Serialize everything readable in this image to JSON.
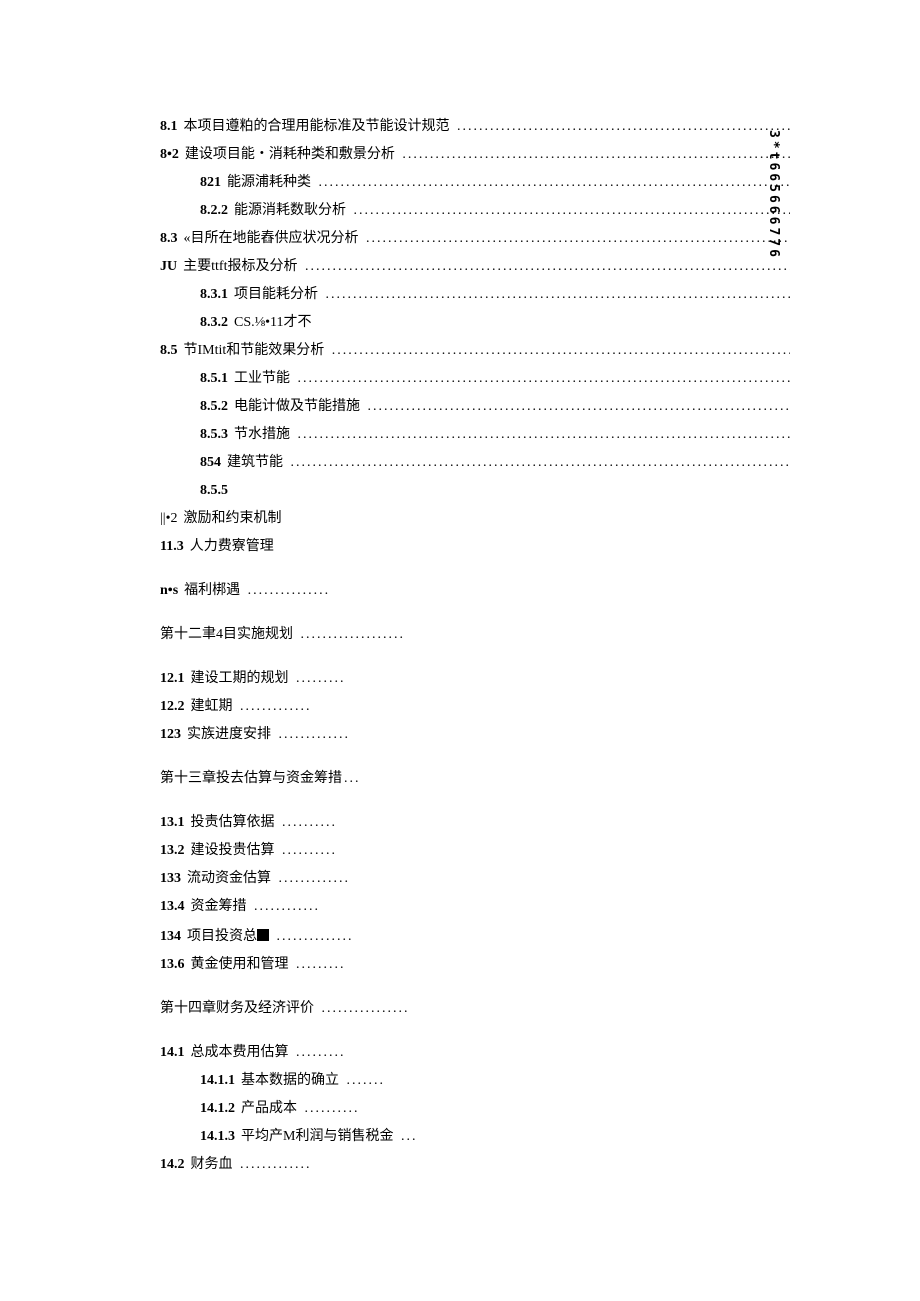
{
  "vertical_note": "3*t665666776",
  "lines": [
    {
      "cls": "toc-line",
      "num_bold": true,
      "num": "8.1",
      "title": "本项目遵粕的合理用能标准及节能设计规范",
      "dots": "long"
    },
    {
      "cls": "toc-line",
      "num_bold": true,
      "num": "8•2",
      "title": "建设项目能・消耗种类和敷景分析",
      "dots": "long"
    },
    {
      "cls": "toc-line indent-1",
      "num_bold": true,
      "num": "821",
      "title": "能源浦耗种类",
      "dots": "long"
    },
    {
      "cls": "toc-line indent-1",
      "num_bold": true,
      "num": "8.2.2",
      "title": "能源消耗数耿分析",
      "dots": "long"
    },
    {
      "cls": "toc-line",
      "num_bold": true,
      "num": "8.3",
      "title": "«目所在地能舂供应状况分析",
      "dots": "long"
    },
    {
      "cls": "toc-line",
      "num_bold": true,
      "num": "JU",
      "title": "主要ttft报标及分析",
      "dots": "long"
    },
    {
      "cls": "toc-line indent-1",
      "num_bold": true,
      "num": "8.3.1",
      "title": "  项目能耗分析",
      "dots": "long"
    },
    {
      "cls": "toc-line indent-1",
      "num_bold": true,
      "num": "8.3.2",
      "title": "  CS.⅛•11才不",
      "dots": ""
    },
    {
      "cls": "toc-line",
      "num_bold": true,
      "num": "8.5",
      "title": "  节IMtit和节能效果分析",
      "dots": "long"
    },
    {
      "cls": "toc-line indent-1",
      "num_bold": true,
      "num": "8.5.1",
      "title": "  工业节能",
      "dots": "long"
    },
    {
      "cls": "toc-line indent-1",
      "num_bold": true,
      "num": "8.5.2",
      "title": "  电能计做及节能措施",
      "dots": "long"
    },
    {
      "cls": "toc-line indent-1",
      "num_bold": true,
      "num": "8.5.3",
      "title": "  节水措施",
      "dots": "long"
    },
    {
      "cls": "toc-line indent-1",
      "num_bold": true,
      "num": "854",
      "title": "建筑节能",
      "dots": "long"
    },
    {
      "cls": "toc-line indent-1",
      "num_bold": true,
      "num": "8.5.5",
      "title": "",
      "dots": ""
    },
    {
      "cls": "toc-line",
      "num_bold": false,
      "num": "||•2",
      "title": "激励和约束机制",
      "dots": ""
    },
    {
      "cls": "toc-line",
      "num_bold": true,
      "num": "11.3",
      "title": "人力费寮管理",
      "dots": ""
    }
  ],
  "narrow_lines": [
    {
      "cls": "toc-line",
      "num_bold": true,
      "num": "n•s",
      "title": "福利梆遇",
      "dots": "short"
    }
  ],
  "chapter12": "第十二聿4目实施规划",
  "lines12": [
    {
      "cls": "toc-line",
      "num_bold": true,
      "num": "12.1",
      "title": "  建设工期的规划",
      "dots": "short"
    },
    {
      "cls": "toc-line",
      "num_bold": true,
      "num": "12.2",
      "title": "  建虹期",
      "dots": "short"
    },
    {
      "cls": "toc-line",
      "num_bold": true,
      "num": "123",
      "title": "实族进度安排",
      "dots": "short"
    }
  ],
  "chapter13": "第十三章投去估算与资金筹措",
  "lines13": [
    {
      "cls": "toc-line",
      "num_bold": true,
      "num": "13.1",
      "title": "  投责估算依据",
      "dots": "short"
    },
    {
      "cls": "toc-line",
      "num_bold": true,
      "num": "13.2",
      "title": "  建设投贵估算",
      "dots": "short"
    },
    {
      "cls": "toc-line",
      "num_bold": true,
      "num": "133",
      "title": "流动资金估算",
      "dots": "short"
    },
    {
      "cls": "toc-line",
      "num_bold": true,
      "num": "13.4",
      "title": "  资金筹措",
      "dots": "short"
    },
    {
      "cls": "toc-line",
      "num_bold": true,
      "num": "134",
      "title": "项目投资总",
      "square": true,
      "dots": "short"
    },
    {
      "cls": "toc-line",
      "num_bold": true,
      "num": "13.6",
      "title": "  黄金使用和管理",
      "dots": "short"
    }
  ],
  "chapter14": "第十四章财务及经济评价",
  "lines14": [
    {
      "cls": "toc-line",
      "num_bold": true,
      "num": "14.1",
      "title": "  总成本费用估算",
      "dots": "short"
    },
    {
      "cls": "toc-line indent-1",
      "num_bold": true,
      "num": "14.1.1",
      "title": "  基本数据的确立",
      "dots": "short"
    },
    {
      "cls": "toc-line indent-1",
      "num_bold": true,
      "num": "14.1.2",
      "title": "  产品成本",
      "dots": "short"
    },
    {
      "cls": "toc-line indent-1",
      "num_bold": true,
      "num": "14.1.3",
      "title": "  平均产M利润与销售税金",
      "dots": "short"
    },
    {
      "cls": "toc-line",
      "num_bold": true,
      "num": "14.2",
      "title": "  财务血",
      "dots": "short"
    }
  ]
}
